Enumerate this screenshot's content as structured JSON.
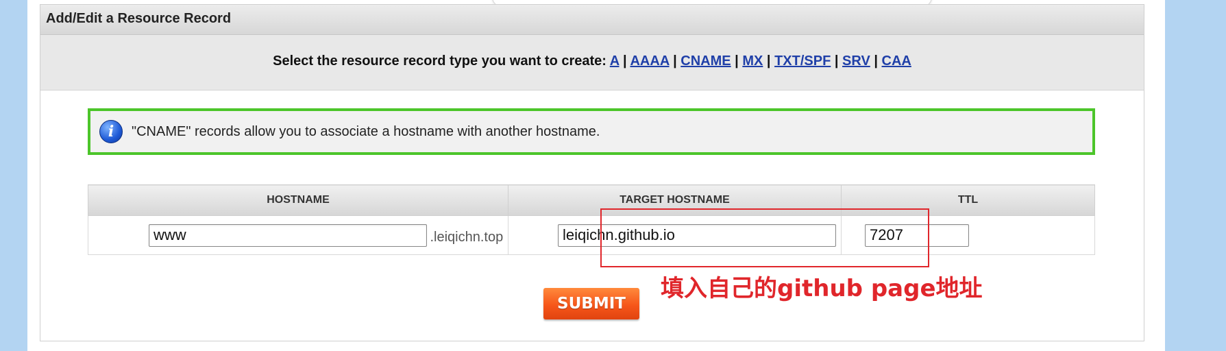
{
  "panel": {
    "title": "Add/Edit a Resource Record"
  },
  "type_selector": {
    "prompt": "Select the resource record type you want to create:",
    "types": [
      "A",
      "AAAA",
      "CNAME",
      "MX",
      "TXT/SPF",
      "SRV",
      "CAA"
    ],
    "separator": "|"
  },
  "info": {
    "icon": "info-icon",
    "message": "\"CNAME\" records allow you to associate a hostname with another hostname."
  },
  "table": {
    "headers": {
      "hostname": "HOSTNAME",
      "target": "TARGET HOSTNAME",
      "ttl": "TTL"
    },
    "row": {
      "hostname_value": "www",
      "domain_suffix": ".leiqichn.top",
      "target_value": "leiqichn.github.io",
      "ttl_value": "7207"
    }
  },
  "submit_label": "SUBMIT",
  "annotation": {
    "text": "填入自己的github page地址",
    "color": "#e0262b"
  },
  "colors": {
    "info_border": "#4cc52a",
    "link": "#1f3fa8",
    "submit": "#f6561a"
  }
}
